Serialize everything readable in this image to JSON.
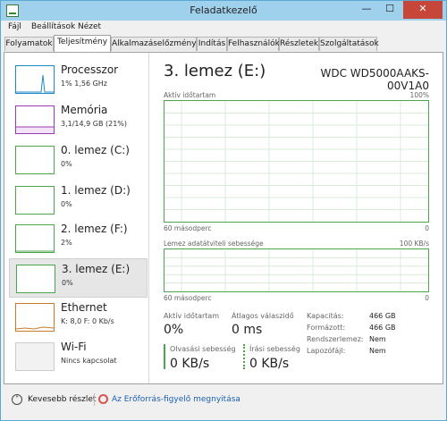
{
  "window": {
    "title": "Feladatkezelő"
  },
  "menu": [
    "Fájl",
    "Beállítások",
    "Nézet"
  ],
  "tabs": [
    "Folyamatok",
    "Teljesítmény",
    "Alkalmazáselőzmények",
    "Indítás",
    "Felhasználók",
    "Részletek",
    "Szolgáltatások"
  ],
  "active_tab": "Teljesítmény",
  "sidebar": [
    {
      "name": "Processzor",
      "sub": "1% 1,56 GHz"
    },
    {
      "name": "Memória",
      "sub": "3,1/14,9 GB (21%)"
    },
    {
      "name": "0. lemez (C:)",
      "sub": "0%"
    },
    {
      "name": "1. lemez (D:)",
      "sub": "0%"
    },
    {
      "name": "2. lemez (F:)",
      "sub": "2%"
    },
    {
      "name": "3. lemez (E:)",
      "sub": "0%"
    },
    {
      "name": "Ethernet",
      "sub": "K: 8,0 F: 0 Kb/s"
    },
    {
      "name": "Wi-Fi",
      "sub": "Nincs kapcsolat"
    }
  ],
  "selected_item": "3. lemez (E:)",
  "main": {
    "title": "3. lemez (E:)",
    "model": "WDC WD5000AAKS-00V1A0",
    "graph1": {
      "label": "Aktív időtartam",
      "max": "100%",
      "time": "60 másodperc",
      "min": "0"
    },
    "graph2": {
      "label": "Lemez adatátviteli sebessége",
      "max": "100 KB/s",
      "time": "60 másodperc",
      "min": "0"
    },
    "stats": {
      "active_label": "Aktív időtartam",
      "active_value": "0%",
      "response_label": "Átlagos válaszidő",
      "response_value": "0 ms",
      "read_label": "Olvasási sebesség",
      "read_value": "0 KB/s",
      "write_label": "Írási sebesség",
      "write_value": "0 KB/s"
    },
    "props": [
      {
        "key": "Kapacitás:",
        "value": "466 GB"
      },
      {
        "key": "Formázott:",
        "value": "466 GB"
      },
      {
        "key": "Rendszerlemez:",
        "value": "Nem"
      },
      {
        "key": "Lapozófájl:",
        "value": "Nem"
      }
    ]
  },
  "footer": {
    "fewer": "Kevesebb részlet",
    "resource_monitor": "Az Erőforrás-figyelő megnyitása"
  },
  "colors": {
    "disk": "#4ca44c",
    "cpu": "#1f88c9",
    "memory": "#9b38b5",
    "ethernet": "#c97b2a",
    "link": "#1a5fb4"
  }
}
